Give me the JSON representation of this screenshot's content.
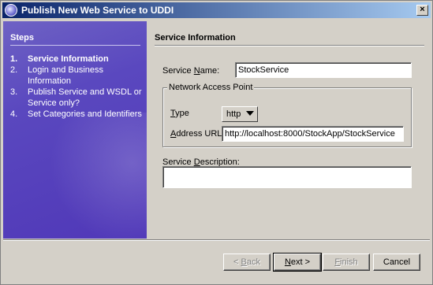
{
  "window": {
    "title": "Publish New Web Service to UDDI"
  },
  "steps": {
    "heading": "Steps",
    "items": [
      {
        "num": "1.",
        "label": "Service Information",
        "active": true
      },
      {
        "num": "2.",
        "label": "Login and Business Information",
        "active": false
      },
      {
        "num": "3.",
        "label": "Publish Service and WSDL or Service only?",
        "active": false
      },
      {
        "num": "4.",
        "label": "Set Categories and Identifiers",
        "active": false
      }
    ]
  },
  "form": {
    "heading": "Service Information",
    "service_name": {
      "label_pre": "Service ",
      "label_key": "N",
      "label_post": "ame:",
      "value": "StockService"
    },
    "network_access_point": {
      "title": "Network Access Point",
      "type": {
        "label_key": "T",
        "label_post": "ype",
        "value": "http"
      },
      "address_url": {
        "label_key": "A",
        "label_post": "ddress URL:",
        "value": "http://localhost:8000/StockApp/StockService"
      }
    },
    "service_description": {
      "label_pre": "Service ",
      "label_key": "D",
      "label_post": "escription:",
      "value": ""
    }
  },
  "buttons": {
    "back": {
      "label_pre": "< ",
      "label_key": "B",
      "label_post": "ack",
      "enabled": false
    },
    "next": {
      "label_pre": "",
      "label_key": "N",
      "label_post": "ext >",
      "enabled": true
    },
    "finish": {
      "label_pre": "",
      "label_key": "F",
      "label_post": "inish",
      "enabled": false
    },
    "cancel": {
      "label": "Cancel",
      "enabled": true
    }
  }
}
